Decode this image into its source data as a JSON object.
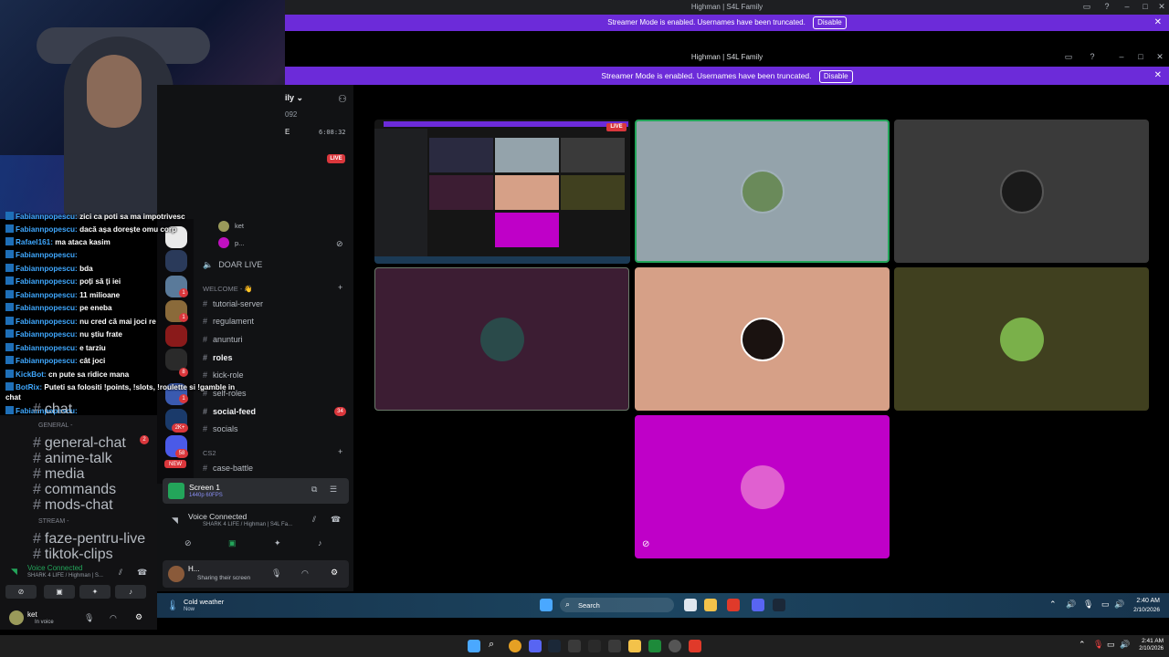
{
  "outer_window": {
    "title": "Highman | S4L Family",
    "streamer_text": "Streamer Mode is enabled. Usernames have been truncated.",
    "disable_label": "Disable"
  },
  "inner_window": {
    "title": "Highman | S4L Family",
    "streamer_text": "Streamer Mode is enabled. Usernames have been truncated.",
    "disable_label": "Disable"
  },
  "chat": {
    "lines": [
      {
        "user": "Fabiannpopescu:",
        "msg": "zici ca poti sa ma impotrivesc"
      },
      {
        "user": "Fabiannpopescu:",
        "msg": "dacă așa dorește omu corp"
      },
      {
        "user": "Rafael161:",
        "msg": "ma ataca kasim"
      },
      {
        "user": "Fabiannpopescu:",
        "msg": ""
      },
      {
        "user": "Fabiannpopescu:",
        "msg": "bda"
      },
      {
        "user": "Fabiannpopescu:",
        "msg": "poți să ți iei"
      },
      {
        "user": "Fabiannpopescu:",
        "msg": "11 milioane"
      },
      {
        "user": "Fabiannpopescu:",
        "msg": "pe eneba"
      },
      {
        "user": "Fabiannpopescu:",
        "msg": "nu cred că mai joci re"
      },
      {
        "user": "Fabiannpopescu:",
        "msg": "nu știu frate"
      },
      {
        "user": "Fabiannpopescu:",
        "msg": "e tarziu"
      },
      {
        "user": "Fabiannpopescu:",
        "msg": "cât joci"
      },
      {
        "user": "KickBot:",
        "msg": "cn pute sa ridice mana"
      },
      {
        "user": "BotRix:",
        "msg": "Puteti sa folositi !points, !slots, !roulette si !gamble in"
      },
      {
        "user": "",
        "msg": "chat"
      },
      {
        "user": "Fabiannpopescu:",
        "msg": ""
      }
    ]
  },
  "left_sidebar": {
    "categories": [
      {
        "label": "GENERAL -"
      },
      {
        "label": "STREAM -"
      }
    ],
    "channels": [
      {
        "label": "chat"
      },
      {
        "label": "general-chat",
        "badge": "2"
      },
      {
        "label": "anime-talk"
      },
      {
        "label": "media"
      },
      {
        "label": "commands"
      },
      {
        "label": "mods-chat"
      },
      {
        "label": "faze-pentru-live"
      },
      {
        "label": "tiktok-clips"
      }
    ],
    "voice": {
      "status": "Voice Connected",
      "server": "SHARK 4 LIFE / Highman | S..."
    },
    "user": {
      "name": "ket",
      "status": "In voice"
    }
  },
  "mid_panel": {
    "server_name": "ily",
    "counter": "092",
    "timer": "6:08:32",
    "live_badge": "LIVE",
    "voice_users": [
      "ket",
      "p..."
    ],
    "top_channel": "DOAR LIVE",
    "welcome_category": "WELCOME - 👋",
    "channels": [
      {
        "label": "tutorial-server",
        "bold": false
      },
      {
        "label": "regulament",
        "bold": false
      },
      {
        "label": "anunturi",
        "bold": false
      },
      {
        "label": "roles",
        "bold": true
      },
      {
        "label": "kick-role",
        "bold": false
      },
      {
        "label": "self-roles",
        "bold": false
      },
      {
        "label": "social-feed",
        "bold": true,
        "badge": "34"
      },
      {
        "label": "socials",
        "bold": false
      }
    ],
    "cs2_category": "CS2",
    "case_channel": "case-battle",
    "server_badges": [
      "1",
      "1",
      "8",
      "1",
      "2K+",
      "58",
      "NEW"
    ],
    "screen_card": {
      "title": "Screen 1",
      "sub": "1440p 60FPS"
    },
    "voice": {
      "status": "Voice Connected",
      "server": "SHARK 4 LIFE / Highman | S4L Fa..."
    },
    "user": {
      "name": "H...",
      "status": "Sharing their screen"
    }
  },
  "stream_grid": {
    "live_label": "LIVE",
    "tile_colors": [
      "#94a3ab",
      "#3a3a3a",
      "#3c1d33",
      "#d6a087",
      "#40401f",
      "#bf00c8"
    ]
  },
  "inner_taskbar": {
    "weather_title": "Cold weather",
    "weather_sub": "Now",
    "search_placeholder": "Search",
    "time": "2:40 AM",
    "date": "2/10/2026"
  },
  "outer_taskbar": {
    "time": "2:41 AM",
    "date": "2/10/2026"
  },
  "colors": {
    "streamer_purple": "#6c2bd9",
    "discord_red": "#da373c",
    "voice_green": "#23a55a"
  }
}
